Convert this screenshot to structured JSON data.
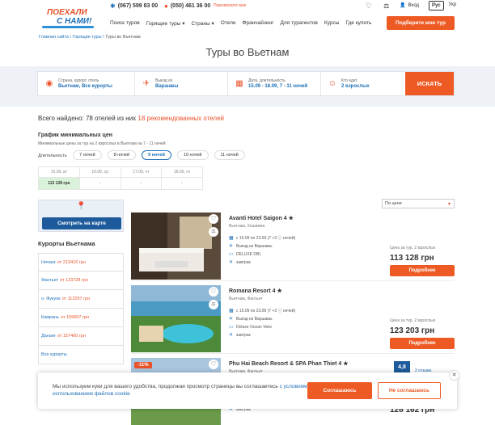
{
  "header": {
    "logo_line1": "ПОЕХАЛИ",
    "logo_line2": "С НАМИ!",
    "phone1": "(067) 599 83 00",
    "phone2": "(050) 461 36 00",
    "callback": "Перезвоните мне",
    "login": "Вход",
    "lang_ru": "Рус",
    "lang_ua": "Укр",
    "nav": [
      "Поиск туров",
      "Горящие туры ▾",
      "Страны ▾",
      "Отели",
      "Франчайзинг",
      "Для турагентов",
      "Курсы",
      "Где купить"
    ],
    "pick_button": "Подберите мне тур"
  },
  "breadcrumb": {
    "home": "Главная сайта",
    "hot": "Горящие туры",
    "current": "Туры во Вьетнам"
  },
  "page_title": "Туры во Вьетнам",
  "search": {
    "dest_label": "Страна, курорт, отель",
    "dest_value": "Вьетнам, Все курорты",
    "dep_label": "Выезд из",
    "dep_value": "Варшавы",
    "date_label": "Дата, длительность",
    "date_value": "15.09 - 18.09, 7 - 11 ночей",
    "who_label": "Кто едет",
    "who_value": "2 взрослых",
    "button": "ИСКАТЬ"
  },
  "results": {
    "found": "Всего найдено: 78 отелей из них",
    "recommended": "18 рекомендованных отелей"
  },
  "price_graph": {
    "title": "График минимальных цен",
    "subtitle": "Минимальные цены за тур на 2 взрослых в Вьетнам на 7 - 11 ночей",
    "duration_label": "Длительность",
    "durations": [
      "7 ночей",
      "8 ночей",
      "9 ночей",
      "10 ночей",
      "11 ночей"
    ],
    "dates": [
      "15.09, вт",
      "16.09, ср",
      "17.09, чт",
      "18.09, пт"
    ],
    "prices": [
      "113 128 грн",
      "-",
      "-",
      "-"
    ]
  },
  "map_button": "Смотреть на карте",
  "resorts": {
    "title": "Курорты Вьетнама",
    "items": [
      {
        "name": "Нячанг",
        "price": "от 213416 грн"
      },
      {
        "name": "Фантьет",
        "price": "от 123728 грн"
      },
      {
        "name": "о. Фукуок",
        "price": "от 112297 грн"
      },
      {
        "name": "Камрань",
        "price": "от 159007 грн"
      },
      {
        "name": "Дананг",
        "price": "от 157460 грн"
      },
      {
        "name": "Все курорты",
        "price": ""
      }
    ]
  },
  "sort": "По цене",
  "hotels": [
    {
      "name": "Avanti Hotel Saigon 4 ★",
      "loc": "Вьетнам, Хошимин",
      "dates": "с 15.09 по 23.09 (7 +2 ⓘ ночей)",
      "dep": "Выезд из Варшавы",
      "room": "DELUXE DBL",
      "meal": "завтрак",
      "price_label": "Цена за тур, 2 взрослых",
      "price": "113 128 грн",
      "btn": "Подробнее"
    },
    {
      "name": "Romana Resort 4 ★",
      "loc": "Вьетнам, Фантьет",
      "dates": "с 15.09 по 23.09 (7 +2 ⓘ ночей)",
      "dep": "Выезд из Варшавы",
      "room": "Deluxe Ocean View",
      "meal": "завтрак",
      "price_label": "Цена за тур, 2 взрослых",
      "price": "123 203 грн",
      "btn": "Подробнее"
    },
    {
      "name": "Phu Hai Beach Resort & SPA Phan Thiet 4 ★",
      "loc": "Вьетнам, Фантьет",
      "dates": "",
      "dep": "",
      "room": "",
      "meal": "завтрак",
      "price_label": "",
      "price": "126 162 грн",
      "btn": "",
      "discount": "-11%",
      "rating": "4,8",
      "reviews": "2 отзыва"
    }
  ],
  "cookie": {
    "text": "Мы используем куки для вашего удобства, продолжая просмотр страницы вы соглашаетесь",
    "link": "с условиями использованием файлов cookie",
    "agree": "Соглашаюсь",
    "disagree": "Не соглашаюсь"
  },
  "colors": {
    "accent": "#ee5a24",
    "brand": "#1d6fb8"
  }
}
